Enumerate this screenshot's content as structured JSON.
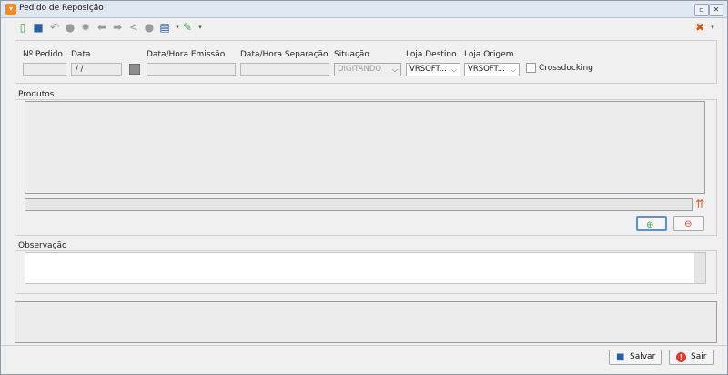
{
  "window": {
    "title": "Pedido de Reposição",
    "controls": [
      "restore",
      "close"
    ]
  },
  "toolbar": {
    "icons": [
      "new-icon",
      "save-icon",
      "undo-icon",
      "circle-icon",
      "gear-icon",
      "arrow-left-icon",
      "arrow-right-icon",
      "share-icon",
      "circle-icon",
      "print-icon",
      "export-icon"
    ],
    "tools_icon": "tools-icon"
  },
  "header_fields": {
    "numero_pedido": {
      "label": "Nº Pedido",
      "value": ""
    },
    "data": {
      "label": "Data",
      "value": " / /"
    },
    "data_hora_emissao": {
      "label": "Data/Hora Emissão",
      "value": ""
    },
    "data_hora_separacao": {
      "label": "Data/Hora Separação",
      "value": ""
    },
    "situacao": {
      "label": "Situação",
      "value": "DIGITANDO"
    },
    "loja_destino": {
      "label": "Loja Destino",
      "value": "VRSOFT..."
    },
    "loja_origem": {
      "label": "Loja Origem",
      "value": "VRSOFT..."
    },
    "crossdocking": {
      "label": "Crossdocking",
      "checked": false
    }
  },
  "produtos": {
    "label": "Produtos"
  },
  "observacao": {
    "label": "Observação",
    "value": ""
  },
  "footer": {
    "salvar_label": "Salvar",
    "sair_label": "Sair"
  },
  "colors": {
    "accent": "#f08a24",
    "title_bar": "#dfe7f3",
    "add": "#3aa34a",
    "remove": "#e04040"
  }
}
